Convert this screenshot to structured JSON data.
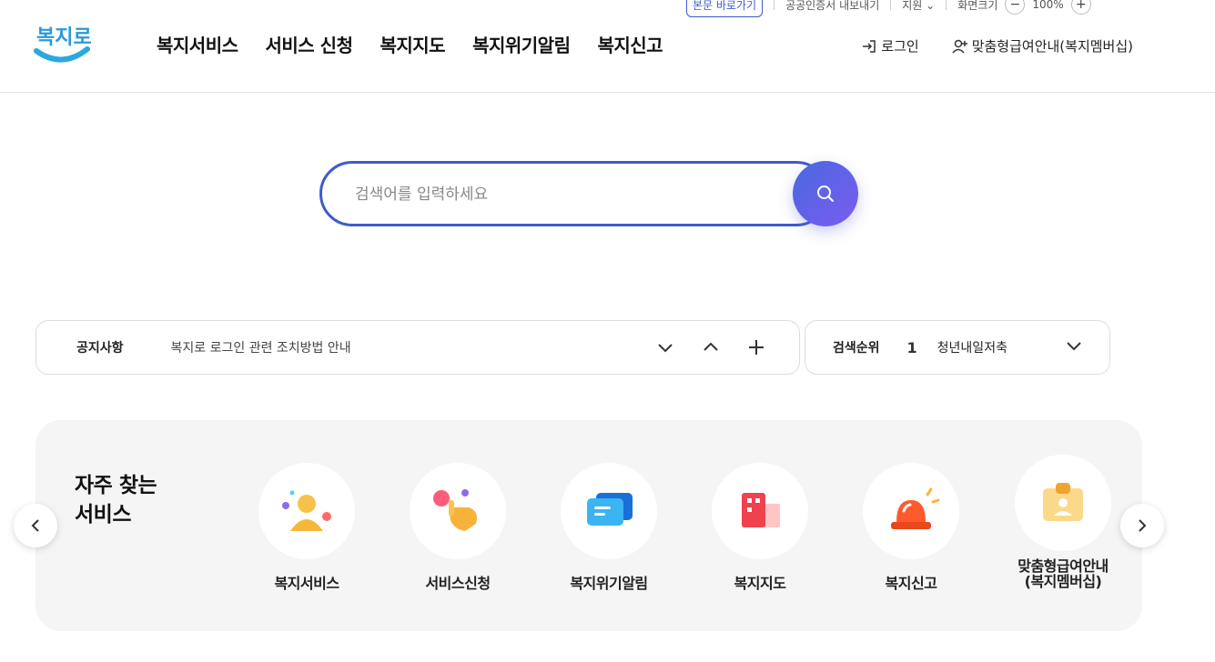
{
  "utility": {
    "skip_label": "본문 바로가기",
    "share_label": "공공인증서 내보내기",
    "lang_label": "지원",
    "zoom_label": "화면크기",
    "zoom_minus": "−",
    "zoom_value": "100%",
    "zoom_plus": "+"
  },
  "header": {
    "logo_text": "복지로",
    "nav": [
      "복지서비스",
      "서비스 신청",
      "복지지도",
      "복지위기알림",
      "복지신고"
    ],
    "login_label": "로그인",
    "membership_label": "맞춤형급여안내(복지멤버십)"
  },
  "search": {
    "placeholder": "검색어를 입력하세요",
    "value": ""
  },
  "notice": {
    "label": "공지사항",
    "text": "복지로 로그인 관련 조치방법 안내"
  },
  "rank": {
    "label": "검색순위",
    "number": "1",
    "keyword": "청년내일저축계좌"
  },
  "frequent": {
    "title_line1": "자주 찾는",
    "title_line2": "서비스",
    "items": [
      {
        "line1": "복지서비스",
        "line2": ""
      },
      {
        "line1": "서비스신청",
        "line2": ""
      },
      {
        "line1": "복지위기알림",
        "line2": ""
      },
      {
        "line1": "복지지도",
        "line2": ""
      },
      {
        "line1": "복지신고",
        "line2": ""
      },
      {
        "line1": "맞춤형급여안내",
        "line2": "(복지멤버십)"
      }
    ]
  },
  "colors": {
    "brand_blue": "#3f5ccc",
    "search_gradient_start": "#4a68e0",
    "search_gradient_end": "#7a5cf0",
    "panel_bg": "#f5f5f5"
  }
}
